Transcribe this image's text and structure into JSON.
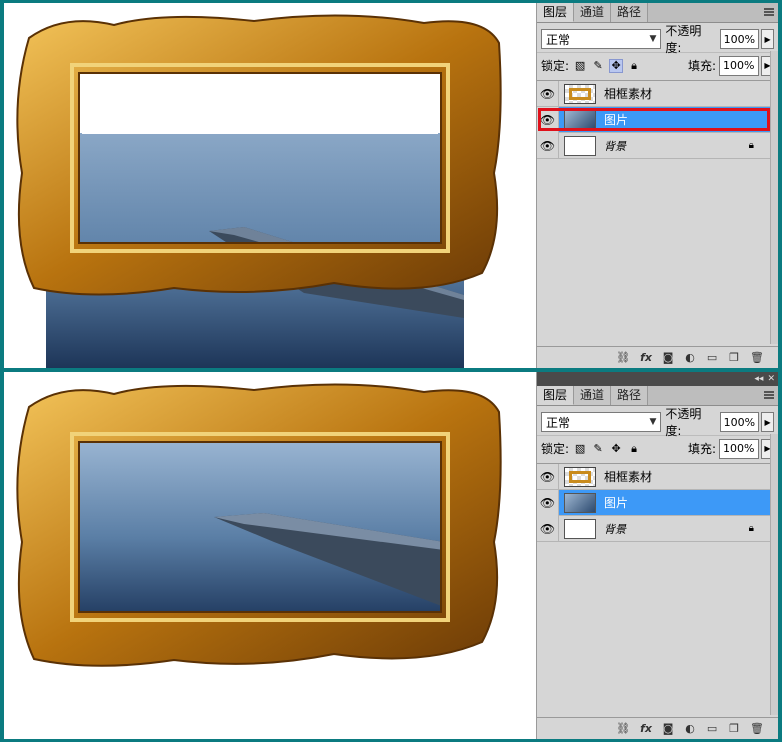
{
  "panels": [
    {
      "tabs": [
        "图层",
        "通道",
        "路径"
      ],
      "blend_mode": "正常",
      "opacity_label": "不透明度:",
      "opacity_value": "100%",
      "lock_label": "锁定:",
      "fill_label": "填充:",
      "fill_value": "100%",
      "layers": [
        {
          "name": "相框素材"
        },
        {
          "name": "图片"
        },
        {
          "name": "背景"
        }
      ]
    },
    {
      "tabs": [
        "图层",
        "通道",
        "路径"
      ],
      "blend_mode": "正常",
      "opacity_label": "不透明度:",
      "opacity_value": "100%",
      "lock_label": "锁定:",
      "fill_label": "填充:",
      "fill_value": "100%",
      "layers": [
        {
          "name": "相框素材"
        },
        {
          "name": "图片"
        },
        {
          "name": "背景"
        }
      ]
    }
  ],
  "colors": {
    "frame_gold": "#c98b1c",
    "selection_blue": "#3d99f7",
    "highlight_red": "#e0101a",
    "photo_blue": "#5b7fa6"
  }
}
